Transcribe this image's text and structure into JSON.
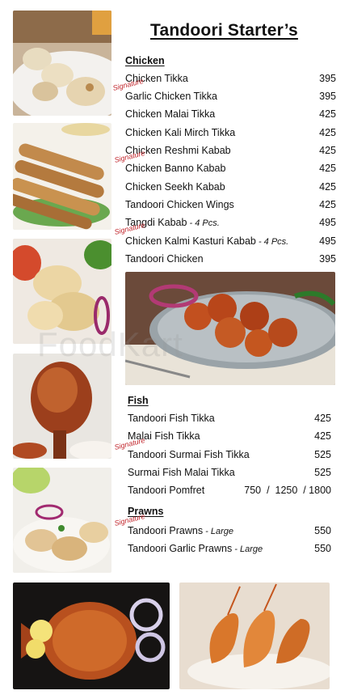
{
  "menu": {
    "title": "Tandoori Starter’s",
    "signature_label": "Signature",
    "watermark": "FoodKart",
    "sections": [
      {
        "heading": "Chicken",
        "items": [
          {
            "name": "Chicken Tikka",
            "note": "",
            "price": "395"
          },
          {
            "name": "Garlic Chicken Tikka",
            "note": "",
            "price": "395"
          },
          {
            "name": "Chicken Malai Tikka",
            "note": "",
            "price": "425"
          },
          {
            "name": "Chicken Kali Mirch Tikka",
            "note": "",
            "price": "425"
          },
          {
            "name": "Chicken Reshmi Kabab",
            "note": "",
            "price": "425"
          },
          {
            "name": "Chicken Banno Kabab",
            "note": "",
            "price": "425"
          },
          {
            "name": "Chicken Seekh Kabab",
            "note": "",
            "price": "425"
          },
          {
            "name": "Tandoori Chicken Wings",
            "note": "",
            "price": "425"
          },
          {
            "name": "Tangdi Kabab",
            "note": " - 4 Pcs.",
            "price": "495"
          },
          {
            "name": "Chicken Kalmi Kasturi Kabab",
            "note": " - 4 Pcs.",
            "price": "495"
          },
          {
            "name": "Tandoori Chicken",
            "note": "",
            "price": "395"
          }
        ]
      },
      {
        "heading": "Fish",
        "items": [
          {
            "name": "Tandoori Fish Tikka",
            "note": "",
            "price": "425"
          },
          {
            "name": "Malai  Fish Tikka",
            "note": "",
            "price": "425"
          },
          {
            "name": "Tandoori Surmai Fish Tikka",
            "note": "",
            "price": "525"
          },
          {
            "name": "Surmai Fish Malai Tikka",
            "note": "",
            "price": "525"
          },
          {
            "name": "Tandoori Pomfret",
            "note": "",
            "price": "750  /  1250  / 1800"
          }
        ]
      },
      {
        "heading": "Prawns",
        "items": [
          {
            "name": "Tandoori Prawns",
            "note": " - Large",
            "price": "550"
          },
          {
            "name": "Tandoori Garlic Prawns",
            "note": " - Large",
            "price": "550"
          }
        ]
      }
    ]
  }
}
